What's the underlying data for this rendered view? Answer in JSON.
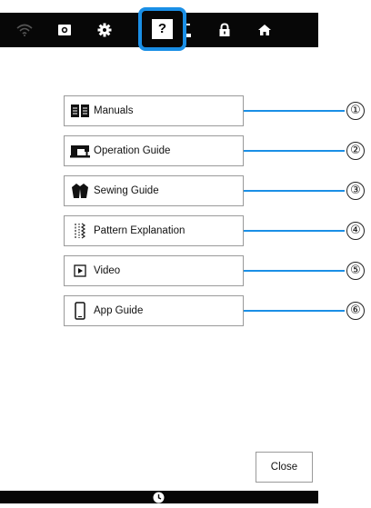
{
  "toolbar": {
    "icons": [
      "wifi-icon",
      "camera-icon",
      "settings-gear-icon",
      "help-icon",
      "needle-icon",
      "lock-icon",
      "home-icon"
    ],
    "help_label": "?"
  },
  "menu": {
    "items": [
      {
        "label": "Manuals",
        "icon": "book-icon",
        "callout": "①"
      },
      {
        "label": "Operation Guide",
        "icon": "sewing-machine-icon",
        "callout": "②"
      },
      {
        "label": "Sewing Guide",
        "icon": "jacket-icon",
        "callout": "③"
      },
      {
        "label": "Pattern Explanation",
        "icon": "stitch-pattern-icon",
        "callout": "④"
      },
      {
        "label": "Video",
        "icon": "play-icon",
        "callout": "⑤"
      },
      {
        "label": "App Guide",
        "icon": "smartphone-icon",
        "callout": "⑥"
      }
    ]
  },
  "footer": {
    "close_label": "Close",
    "clock_icon": "clock-icon"
  },
  "colors": {
    "accent": "#1a8fe6",
    "bar": "#070707"
  }
}
